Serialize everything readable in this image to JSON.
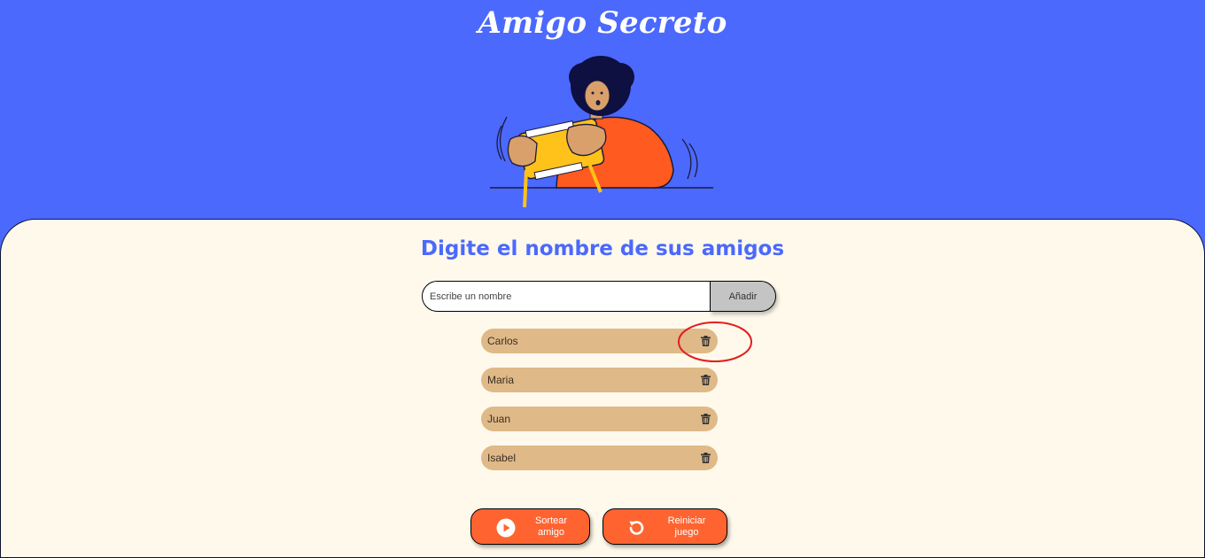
{
  "header": {
    "title": "Amigo Secreto"
  },
  "main": {
    "subtitle": "Digite el nombre de sus amigos",
    "input": {
      "placeholder": "Escribe un nombre",
      "value": ""
    },
    "add_button_label": "Añadir",
    "friends": [
      {
        "name": "Carlos",
        "delete_icon": "trash-icon"
      },
      {
        "name": "Maria",
        "delete_icon": "trash-icon"
      },
      {
        "name": "Juan",
        "delete_icon": "trash-icon"
      },
      {
        "name": "Isabel",
        "delete_icon": "trash-icon"
      }
    ],
    "actions": {
      "draw_label": "Sortear\namigo",
      "draw_icon": "play-icon",
      "reset_label": "Reiniciar\njuego",
      "reset_icon": "reset-icon"
    }
  },
  "colors": {
    "header_bg": "#4b69fd",
    "panel_bg": "#fff9eb",
    "subtitle": "#4b69fd",
    "friend_item_bg": "#dfb987",
    "action_button_bg": "#ff6430",
    "highlight_annotation": "#e02020"
  }
}
